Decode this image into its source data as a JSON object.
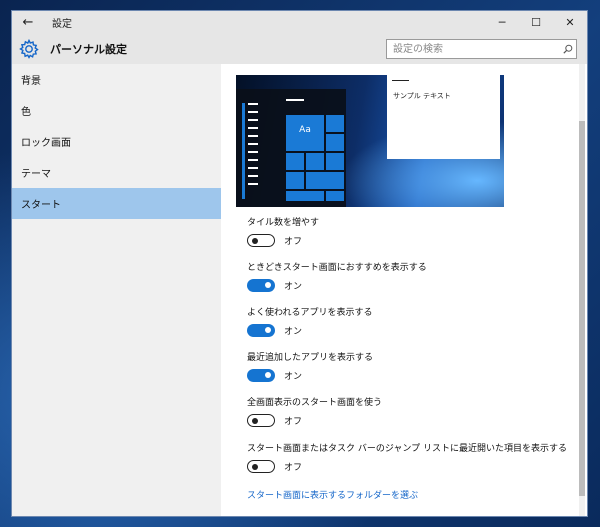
{
  "window": {
    "title": "設定",
    "back_glyph": "←",
    "controls": {
      "minimize": "─",
      "maximize": "☐",
      "close": "✕"
    }
  },
  "header": {
    "title": "パーソナル設定",
    "search_placeholder": "設定の検索"
  },
  "sidebar": {
    "items": [
      {
        "label": "背景",
        "active": false
      },
      {
        "label": "色",
        "active": false
      },
      {
        "label": "ロック画面",
        "active": false
      },
      {
        "label": "テーマ",
        "active": false
      },
      {
        "label": "スタート",
        "active": true
      }
    ]
  },
  "preview": {
    "tile_label": "Aa",
    "dialog_text": "サンプル テキスト"
  },
  "settings": [
    {
      "label": "タイル数を増やす",
      "state": "オフ",
      "on": false
    },
    {
      "label": "ときどきスタート画面におすすめを表示する",
      "state": "オン",
      "on": true
    },
    {
      "label": "よく使われるアプリを表示する",
      "state": "オン",
      "on": true
    },
    {
      "label": "最近追加したアプリを表示する",
      "state": "オン",
      "on": true
    },
    {
      "label": "全画面表示のスタート画面を使う",
      "state": "オフ",
      "on": false
    },
    {
      "label": "スタート画面またはタスク バーのジャンプ リストに最近開いた項目を表示する",
      "state": "オフ",
      "on": false
    }
  ],
  "link_text": "スタート画面に表示するフォルダーを選ぶ",
  "colors": {
    "accent": "#1574d1",
    "active_nav": "#9ec6ec",
    "link": "#1466c9"
  }
}
